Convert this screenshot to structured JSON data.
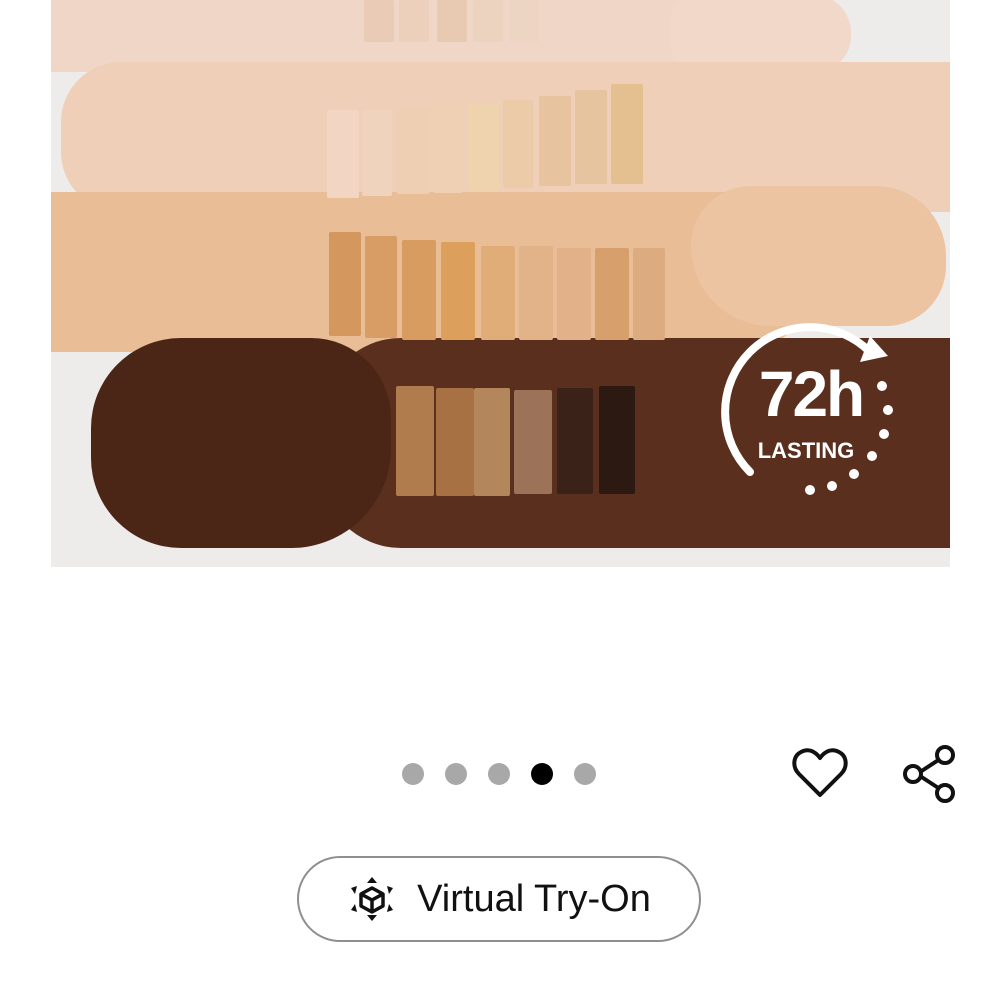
{
  "product": {
    "badge": {
      "value": "72h",
      "caption": "LASTING"
    }
  },
  "carousel": {
    "total": 5,
    "active_index": 3
  },
  "actions": {
    "wishlist_icon": "heart-icon",
    "share_icon": "share-icon"
  },
  "try_on": {
    "label": "Virtual Try-On",
    "icon": "ar-cube-icon"
  },
  "colors": {
    "active_dot": "#000000",
    "inactive_dot": "#a8a8a8",
    "pill_border": "#8f8f8f"
  }
}
